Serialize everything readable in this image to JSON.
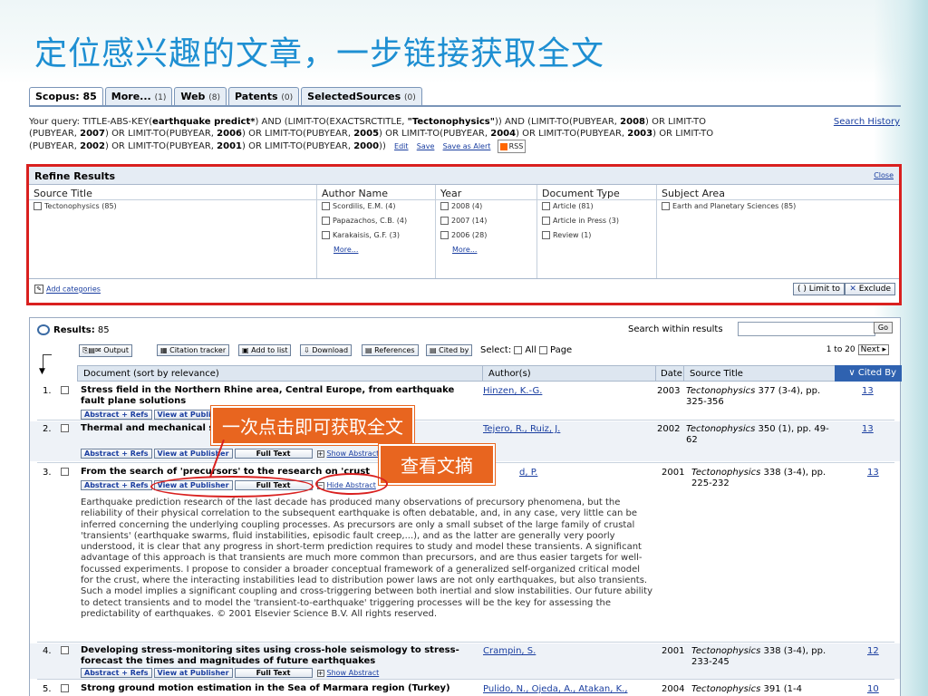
{
  "slide": {
    "title": "定位感兴趣的文章，一步链接获取全文"
  },
  "tabs": [
    {
      "label": "Scopus: 85",
      "count": ""
    },
    {
      "label": "More...",
      "count": "(1)"
    },
    {
      "label": "Web",
      "count": "(8)"
    },
    {
      "label": "Patents",
      "count": "(0)"
    },
    {
      "label": "SelectedSources",
      "count": "(0)"
    }
  ],
  "query": {
    "line1_pre": "Your query: TITLE-ABS-KEY(",
    "kw1": "earthquake predict*",
    "line1_mid": ") AND (LIMIT-TO(EXACTSRCTITLE, ",
    "kw2": "\"Tectonophysics\"",
    "line1_mid2": ")) AND (LIMIT-TO(PUBYEAR, ",
    "y2008": "2008",
    "line1_end": ") OR LIMIT-TO",
    "line2_pre": "(PUBYEAR, ",
    "y2007": "2007",
    "line2_a": ") OR LIMIT-TO(PUBYEAR, ",
    "y2006": "2006",
    "line2_b": ") OR LIMIT-TO(PUBYEAR, ",
    "y2005": "2005",
    "line2_c": ") OR LIMIT-TO(PUBYEAR, ",
    "y2004": "2004",
    "line2_d": ") OR LIMIT-TO(PUBYEAR, ",
    "y2003": "2003",
    "line2_end": ") OR LIMIT-TO",
    "line3_pre": "(PUBYEAR, ",
    "y2002": "2002",
    "line3_a": ") OR LIMIT-TO(PUBYEAR, ",
    "y2001": "2001",
    "line3_b": ") OR LIMIT-TO(PUBYEAR, ",
    "y2000": "2000",
    "line3_end": "))",
    "edit": "Edit",
    "save": "Save",
    "save_alert": "Save as Alert",
    "rss": "RSS",
    "search_history": "Search History"
  },
  "refine": {
    "title": "Refine Results",
    "close": "Close",
    "columns": [
      {
        "header": "Source Title",
        "items": [
          "Tectonophysics (85)"
        ],
        "more": ""
      },
      {
        "header": "Author Name",
        "items": [
          "Scordilis, E.M. (4)",
          "Papazachos, C.B. (4)",
          "Karakaisis, G.F. (3)"
        ],
        "more": "More..."
      },
      {
        "header": "Year",
        "items": [
          "2008 (4)",
          "2007 (14)",
          "2006 (28)"
        ],
        "more": "More..."
      },
      {
        "header": "Document Type",
        "items": [
          "Article (81)",
          "Article in Press (3)",
          "Review (1)"
        ],
        "more": ""
      },
      {
        "header": "Subject Area",
        "items": [
          "Earth and Planetary Sciences (85)"
        ],
        "more": ""
      }
    ],
    "add_categories": "Add categories",
    "limit_to": "Limit to",
    "exclude": "Exclude"
  },
  "results": {
    "label": "Results:",
    "count": "85",
    "search_within": "Search within results",
    "go": "Go",
    "toolbar": {
      "output": "Output",
      "citation_tracker": "Citation tracker",
      "add_to_list": "Add to list",
      "download": "Download",
      "references": "References",
      "cited_by": "Cited by",
      "select": "Select:",
      "all": "All",
      "page": "Page",
      "range": "1 to 20",
      "next": "Next"
    },
    "columns": {
      "document": "Document (sort by relevance)",
      "authors": "Author(s)",
      "date": "Date",
      "source": "Source Title",
      "cited": "Cited By"
    },
    "rows": [
      {
        "num": "1.",
        "title": "Stress field in the Northern Rhine area, Central Europe, from earthquake fault plane solutions",
        "authors": "Hinzen, K.-G.",
        "date": "2003",
        "journal": "Tectonophysics",
        "pages": " 377 (3-4), pp. 325-356",
        "cited": "13"
      },
      {
        "num": "2.",
        "title": "Thermal and mechanical s lithosphere",
        "authors": "Tejero, R., Ruiz, J.",
        "date": "2002",
        "journal": "Tectonophysics",
        "pages": " 350 (1), pp. 49-62",
        "cited": "13"
      },
      {
        "num": "3.",
        "title": "From the search of 'precursors' to the research on 'crust",
        "authors": "d, P.",
        "date": "2001",
        "journal": "Tectonophysics",
        "pages": " 338 (3-4), pp. 225-232",
        "cited": "13"
      },
      {
        "num": "4.",
        "title": "Developing stress-monitoring sites using cross-hole seismology to stress-forecast the times and magnitudes of future earthquakes",
        "authors": "Crampin, S.",
        "date": "2001",
        "journal": "Tectonophysics",
        "pages": " 338 (3-4), pp. 233-245",
        "cited": "12"
      },
      {
        "num": "5.",
        "title": "Strong ground motion estimation in the Sea of Marmara region (Turkey)",
        "authors": "Pulido, N., Ojeda, A., Atakan, K.,",
        "date": "2004",
        "journal": "Tectonophysics",
        "pages": " 391 (1-4",
        "cited": "10"
      }
    ],
    "links": {
      "abstract_refs": "Abstract + Refs",
      "view_publisher": "View at Publisher",
      "full_text": "Full Text",
      "show_abstract": "Show Abstract",
      "hide_abstract": "Hide Abstract",
      "view_publis_trunc": "View at Publis"
    },
    "abstract": "Earthquake prediction research of the last decade has produced many observations of precursory phenomena, but the reliability of their physical correlation to the subsequent earthquake is often debatable, and, in any case, very little can be inferred concerning the underlying coupling processes. As precursors are only a small subset of the large family of crustal 'transients' (earthquake swarms, fluid instabilities, episodic fault creep,...), and as the latter are generally very poorly understood, it is clear that any progress in short-term prediction requires to study and model these transients. A significant advantage of this approach is that transients are much more common than precursors, and are thus easier targets for well-focussed experiments. I propose to consider a broader conceptual framework of a generalized self-organized critical model for the crust, where the interacting instabilities lead to distribution power laws are not only earthquakes, but also transients. Such a model implies a significant coupling and cross-triggering between both inertial and slow instabilities. Our future ability to detect transients and to model the 'transient-to-earthquake' triggering processes will be the key for assessing the predictability of earthquakes. © 2001 Elsevier Science B.V. All rights reserved."
  },
  "callouts": {
    "fulltext": "一次点击即可获取全文",
    "abstract": "查看文摘"
  },
  "colors": {
    "title": "#1e8fd2",
    "highlight": "#d9201f",
    "callout": "#e8651f",
    "header_blue": "#2f62b0"
  }
}
